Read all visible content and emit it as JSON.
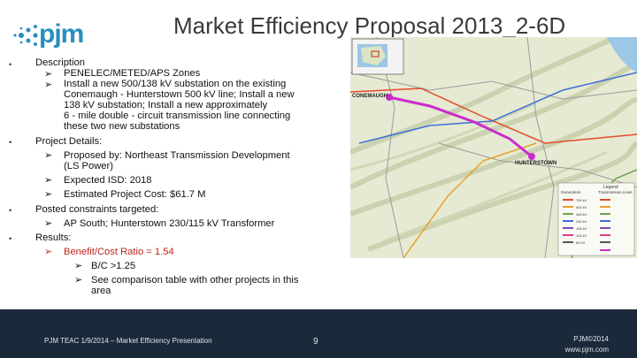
{
  "header": {
    "logo_text": "pjm",
    "title": "Market Efficiency Proposal 2013_2-6D"
  },
  "content": {
    "description_heading": "Description",
    "description_items": [
      "PENELEC/METED/APS Zones",
      "Install a new 500/138 kV substation on the existing",
      "Conemaugh - Hunterstown 500 kV line; Install a new",
      "138 kV substation; Install a new approximately",
      "6 - mile double - circuit transmission line connecting",
      "these two new substations"
    ],
    "project_details_heading": "Project Details:",
    "project_details": [
      "Proposed by: Northeast Transmission Development",
      "(LS Power)",
      "Expected ISD: 2018",
      "Estimated Project Cost: $61.7 M"
    ],
    "constraints_heading": "Posted constraints targeted:",
    "constraints": [
      "AP South; Hunterstown 230/115 kV Transformer"
    ],
    "results_heading": "Results:",
    "results_benefit": "Benefit/Cost Ratio = 1.54",
    "results_sub": [
      "B/C >1.25",
      "See comparison table with other projects in this",
      "area"
    ]
  },
  "map": {
    "labels": {
      "conemaugh": "CONEMAUGH",
      "hunterstown": "HUNTERSTOWN",
      "legend_title": "Legend",
      "legend_col1": "Generators",
      "legend_col2": "Transmission Lines"
    },
    "legend_voltages": [
      "765 kV",
      "500 kV",
      "345 kV",
      "230 kV",
      "138 kV",
      "115 kV",
      "69 kV"
    ],
    "colors": {
      "land": "#e9ecd9",
      "route": "#cc2bcc",
      "line_500": "#e44a2a",
      "line_230": "#3f6fd4",
      "water": "#9cc7e6"
    }
  },
  "footer": {
    "left": "PJM TEAC 1/9/2014 – Market Efficiency Presentation",
    "page": "9",
    "right_line1": "PJM©2014",
    "right_line2": "www.pjm.com"
  }
}
